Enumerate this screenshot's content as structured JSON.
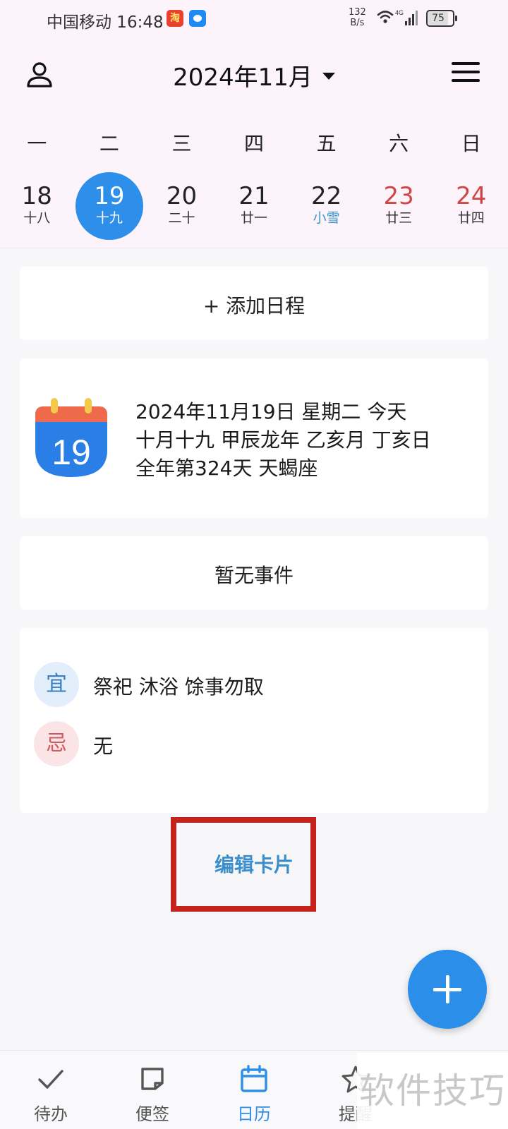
{
  "status_bar": {
    "carrier_time": "中国移动 16:48",
    "taobao_badge": "淘",
    "net_speed_value": "132",
    "net_speed_unit": "B/s",
    "network_type": "4G",
    "battery": "75"
  },
  "header": {
    "month_title": "2024年11月"
  },
  "week": {
    "weekdays": [
      "一",
      "二",
      "三",
      "四",
      "五",
      "六",
      "日"
    ],
    "days": [
      {
        "num": "18",
        "lunar": "十八"
      },
      {
        "num": "19",
        "lunar": "十九"
      },
      {
        "num": "20",
        "lunar": "二十"
      },
      {
        "num": "21",
        "lunar": "廿一"
      },
      {
        "num": "22",
        "lunar": "小雪"
      },
      {
        "num": "23",
        "lunar": "廿三"
      },
      {
        "num": "24",
        "lunar": "廿四"
      }
    ]
  },
  "add_schedule": "+ 添加日程",
  "date_info": {
    "icon_day": "19",
    "line1": "2024年11月19日 星期二 今天",
    "line2": "十月十九 甲辰龙年 乙亥月 丁亥日",
    "line3": "全年第324天 天蝎座"
  },
  "no_events": "暂无事件",
  "almanac": {
    "yi_label": "宜",
    "yi_text": "祭祀 沐浴 馀事勿取",
    "ji_label": "忌",
    "ji_text": "无"
  },
  "edit_card": "编辑卡片",
  "bottom_nav": {
    "todo": "待办",
    "notes": "便签",
    "calendar": "日历",
    "reminder": "提醒"
  },
  "watermark": "软件技巧",
  "colors": {
    "accent": "#2d8fe9",
    "weekend": "#d04545",
    "solar_term": "#3a96c8",
    "highlight_frame": "#c4221a"
  }
}
